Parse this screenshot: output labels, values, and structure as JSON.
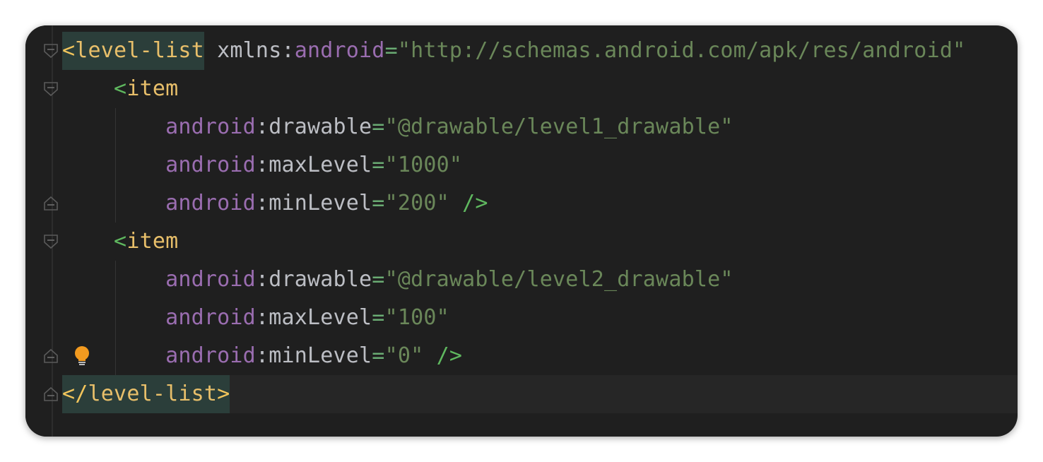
{
  "editor": {
    "lines": [
      {
        "tokens": [
          {
            "text": "<",
            "cls": "t-bracket hl"
          },
          {
            "text": "level-list",
            "cls": "t-tag-bright hl"
          },
          {
            "text": " xmlns",
            "cls": "t-plain"
          },
          {
            "text": ":",
            "cls": "t-plain"
          },
          {
            "text": "android",
            "cls": "t-ns"
          },
          {
            "text": "=",
            "cls": "t-eq"
          },
          {
            "text": "\"http://schemas.android.com/apk/res/android\"",
            "cls": "t-str"
          }
        ],
        "fold": "open"
      },
      {
        "tokens": [
          {
            "text": "    ",
            "cls": "t-plain"
          },
          {
            "text": "<",
            "cls": "t-angle"
          },
          {
            "text": "item",
            "cls": "t-tag-bright"
          }
        ],
        "fold": "open"
      },
      {
        "tokens": [
          {
            "text": "        ",
            "cls": "t-plain"
          },
          {
            "text": "android",
            "cls": "t-ns"
          },
          {
            "text": ":",
            "cls": "t-plain"
          },
          {
            "text": "drawable",
            "cls": "t-attr"
          },
          {
            "text": "=",
            "cls": "t-eq"
          },
          {
            "text": "\"@drawable/level1_drawable\"",
            "cls": "t-str"
          }
        ],
        "guide": true
      },
      {
        "tokens": [
          {
            "text": "        ",
            "cls": "t-plain"
          },
          {
            "text": "android",
            "cls": "t-ns"
          },
          {
            "text": ":",
            "cls": "t-plain"
          },
          {
            "text": "maxLevel",
            "cls": "t-attr"
          },
          {
            "text": "=",
            "cls": "t-eq"
          },
          {
            "text": "\"1000\"",
            "cls": "t-str"
          }
        ],
        "guide": true
      },
      {
        "tokens": [
          {
            "text": "        ",
            "cls": "t-plain"
          },
          {
            "text": "android",
            "cls": "t-ns"
          },
          {
            "text": ":",
            "cls": "t-plain"
          },
          {
            "text": "minLevel",
            "cls": "t-attr"
          },
          {
            "text": "=",
            "cls": "t-eq"
          },
          {
            "text": "\"200\"",
            "cls": "t-str"
          },
          {
            "text": " />",
            "cls": "t-close"
          }
        ],
        "fold": "close",
        "guide": true
      },
      {
        "tokens": [
          {
            "text": "    ",
            "cls": "t-plain"
          },
          {
            "text": "<",
            "cls": "t-angle"
          },
          {
            "text": "item",
            "cls": "t-tag-bright"
          }
        ],
        "fold": "open"
      },
      {
        "tokens": [
          {
            "text": "        ",
            "cls": "t-plain"
          },
          {
            "text": "android",
            "cls": "t-ns"
          },
          {
            "text": ":",
            "cls": "t-plain"
          },
          {
            "text": "drawable",
            "cls": "t-attr"
          },
          {
            "text": "=",
            "cls": "t-eq"
          },
          {
            "text": "\"@drawable/level2_drawable\"",
            "cls": "t-str"
          }
        ],
        "guide": true
      },
      {
        "tokens": [
          {
            "text": "        ",
            "cls": "t-plain"
          },
          {
            "text": "android",
            "cls": "t-ns"
          },
          {
            "text": ":",
            "cls": "t-plain"
          },
          {
            "text": "maxLevel",
            "cls": "t-attr"
          },
          {
            "text": "=",
            "cls": "t-eq"
          },
          {
            "text": "\"100\"",
            "cls": "t-str"
          }
        ],
        "guide": true
      },
      {
        "tokens": [
          {
            "text": "        ",
            "cls": "t-plain"
          },
          {
            "text": "android",
            "cls": "t-ns"
          },
          {
            "text": ":",
            "cls": "t-plain"
          },
          {
            "text": "minLevel",
            "cls": "t-attr"
          },
          {
            "text": "=",
            "cls": "t-eq"
          },
          {
            "text": "\"0\"",
            "cls": "t-str"
          },
          {
            "text": " />",
            "cls": "t-close"
          }
        ],
        "fold": "close",
        "guide": true,
        "bulb": true
      },
      {
        "tokens": [
          {
            "text": "</",
            "cls": "t-bracket hl"
          },
          {
            "text": "level-list",
            "cls": "t-tag-bright hl"
          },
          {
            "text": ">",
            "cls": "t-bracket hl"
          }
        ],
        "fold": "close",
        "current": true
      }
    ]
  },
  "icons": {
    "fold_open": "fold-open-icon",
    "fold_close": "fold-close-icon",
    "bulb": "lightbulb-icon"
  },
  "colors": {
    "background": "#1f1f1f",
    "tag": "#e8bf6a",
    "namespace": "#9a6db0",
    "string": "#6a8759",
    "angle": "#5fb85f",
    "bulb": "#f29a1f"
  }
}
